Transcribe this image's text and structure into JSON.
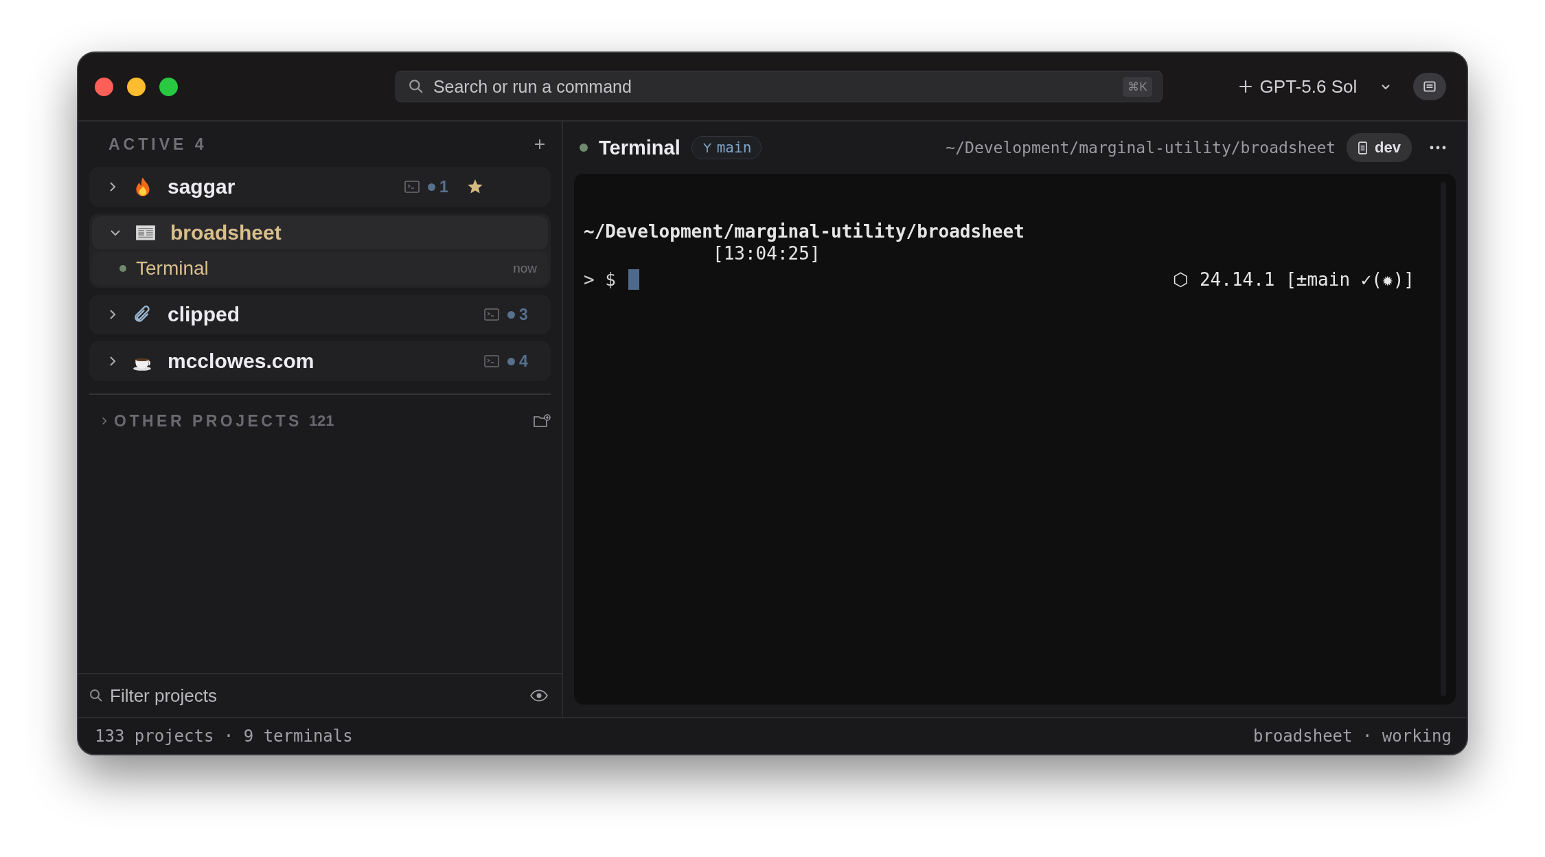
{
  "titlebar": {
    "search": {
      "placeholder": "Search or run a command",
      "shortcut": "⌘K"
    },
    "model": {
      "label": "GPT-5.6 Sol"
    }
  },
  "sidebar": {
    "section": {
      "label": "ACTIVE 4"
    },
    "projects": [
      {
        "name": "saggar",
        "expanded": false,
        "selected": false,
        "count": "1",
        "starred": true
      },
      {
        "name": "broadsheet",
        "expanded": true,
        "selected": true,
        "starred": false,
        "children": [
          {
            "name": "Terminal",
            "time": "now",
            "selected": true
          }
        ]
      },
      {
        "name": "clipped",
        "expanded": false,
        "selected": false,
        "count": "3",
        "starred": false
      },
      {
        "name": "mcclowes.com",
        "expanded": false,
        "selected": false,
        "count": "4",
        "starred": false
      }
    ],
    "other": {
      "label": "OTHER PROJECTS",
      "count": "121",
      "expanded": false
    },
    "filter": {
      "placeholder": "Filter projects"
    }
  },
  "terminal": {
    "title": "Terminal",
    "branch": "main",
    "path": "~/Development/marginal-utility/broadsheet",
    "profile": "dev",
    "lines": [
      {
        "kind": "path",
        "text": "~/Development/marginal-utility/broadsheet"
      },
      {
        "kind": "time",
        "text": "[13:04:25]"
      },
      {
        "kind": "prompt",
        "text": "> $",
        "right": "⬡ 24.14.1 [±main ✓(✹)]"
      }
    ]
  },
  "status_bar": {
    "left": "133 projects · 9 terminals",
    "right": "broadsheet · working"
  }
}
